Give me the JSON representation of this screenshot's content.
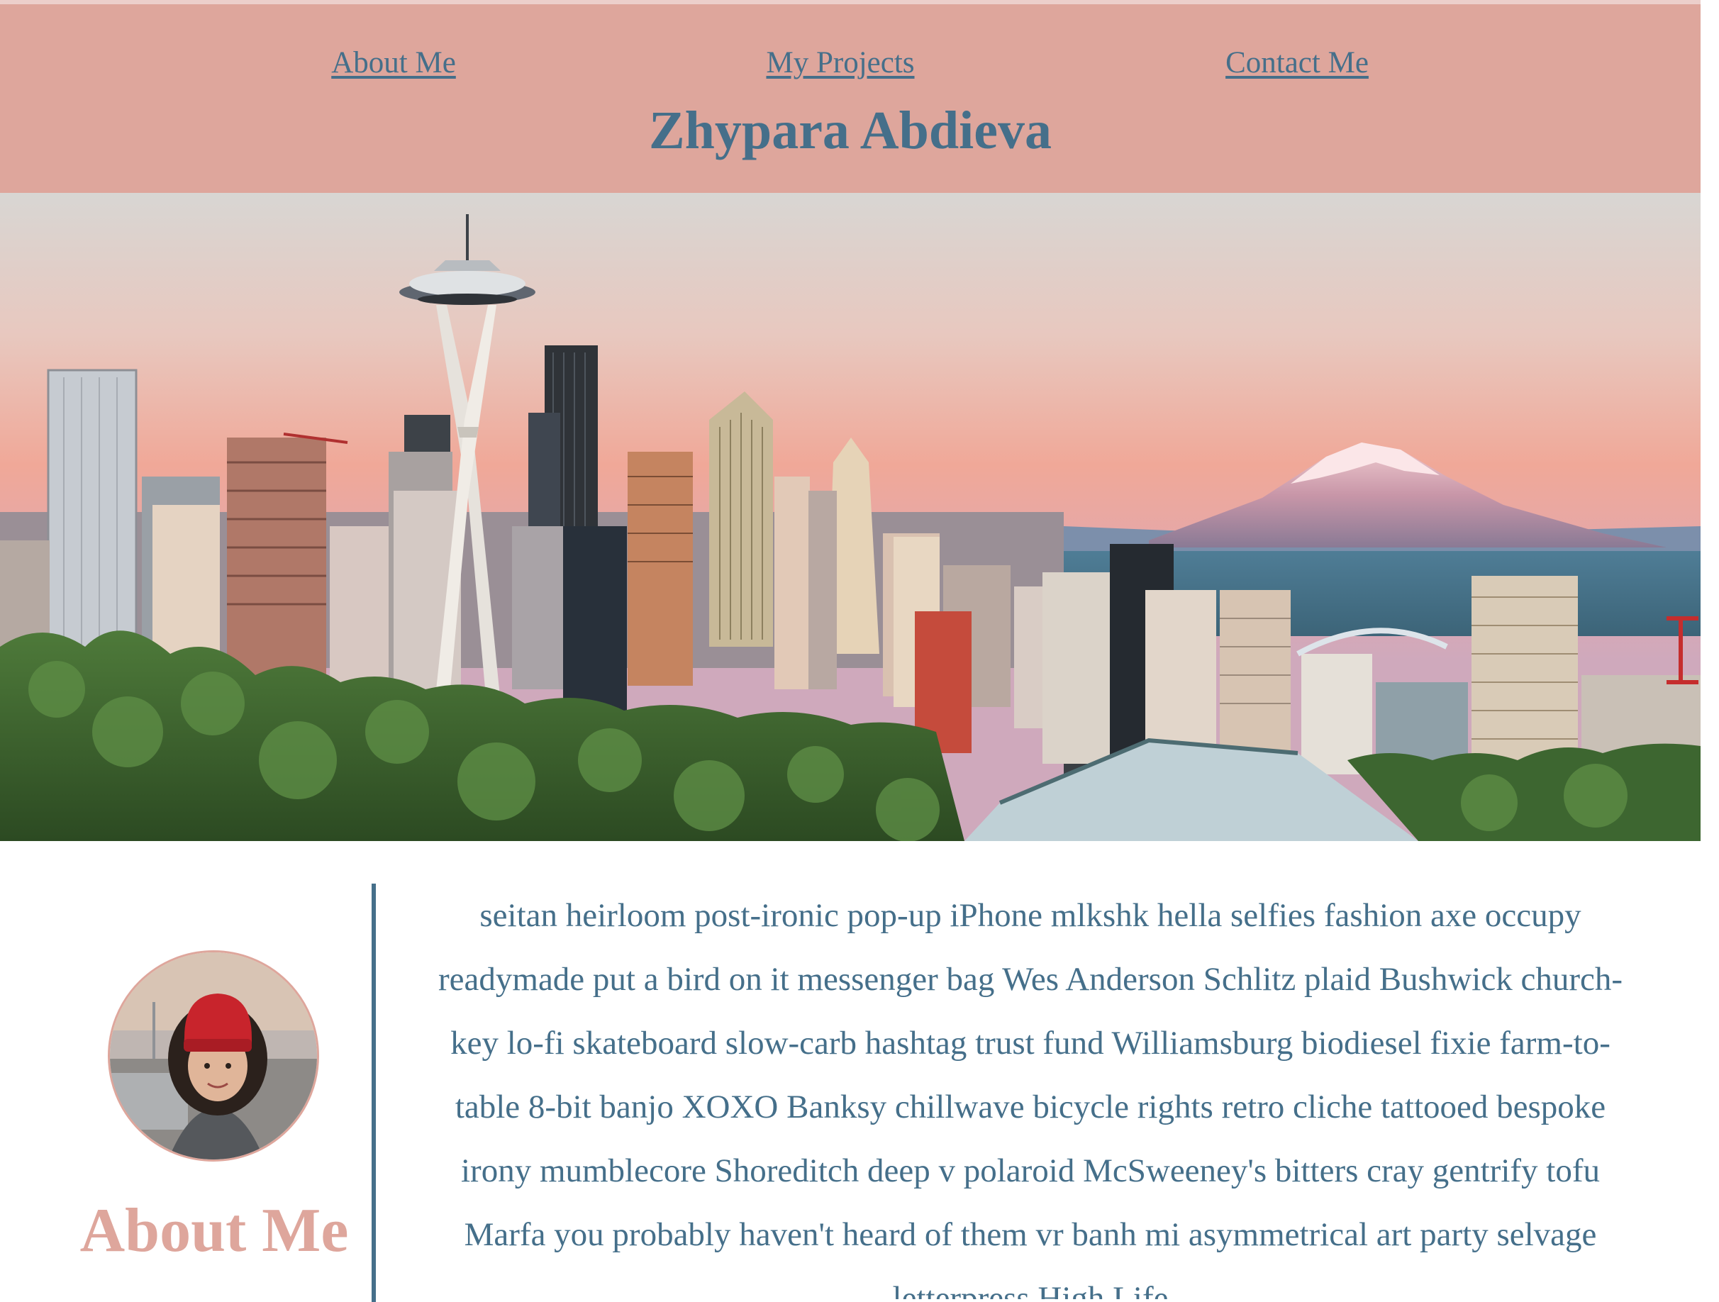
{
  "nav": {
    "about": "About Me",
    "projects": "My Projects",
    "contact": "Contact Me"
  },
  "site_title": "Zhypara Abdieva",
  "about": {
    "heading": "About Me",
    "bio": "seitan heirloom post-ironic pop-up iPhone mlkshk hella selfies fashion axe occupy readymade put a bird on it messenger bag Wes Anderson Schlitz plaid Bushwick church-key lo-fi skateboard slow-carb hashtag trust fund Williamsburg biodiesel fixie farm-to-table 8-bit banjo XOXO Banksy chillwave bicycle rights retro cliche tattooed bespoke irony mumblecore Shoreditch deep v polaroid McSweeney's bitters cray gentrify tofu Marfa you probably haven't heard of them vr banh mi asymmetrical art party selvage letterpress High Life"
  },
  "colors": {
    "header_bg": "#dea69c",
    "text_primary": "#456f8a",
    "accent": "#dea69c"
  }
}
